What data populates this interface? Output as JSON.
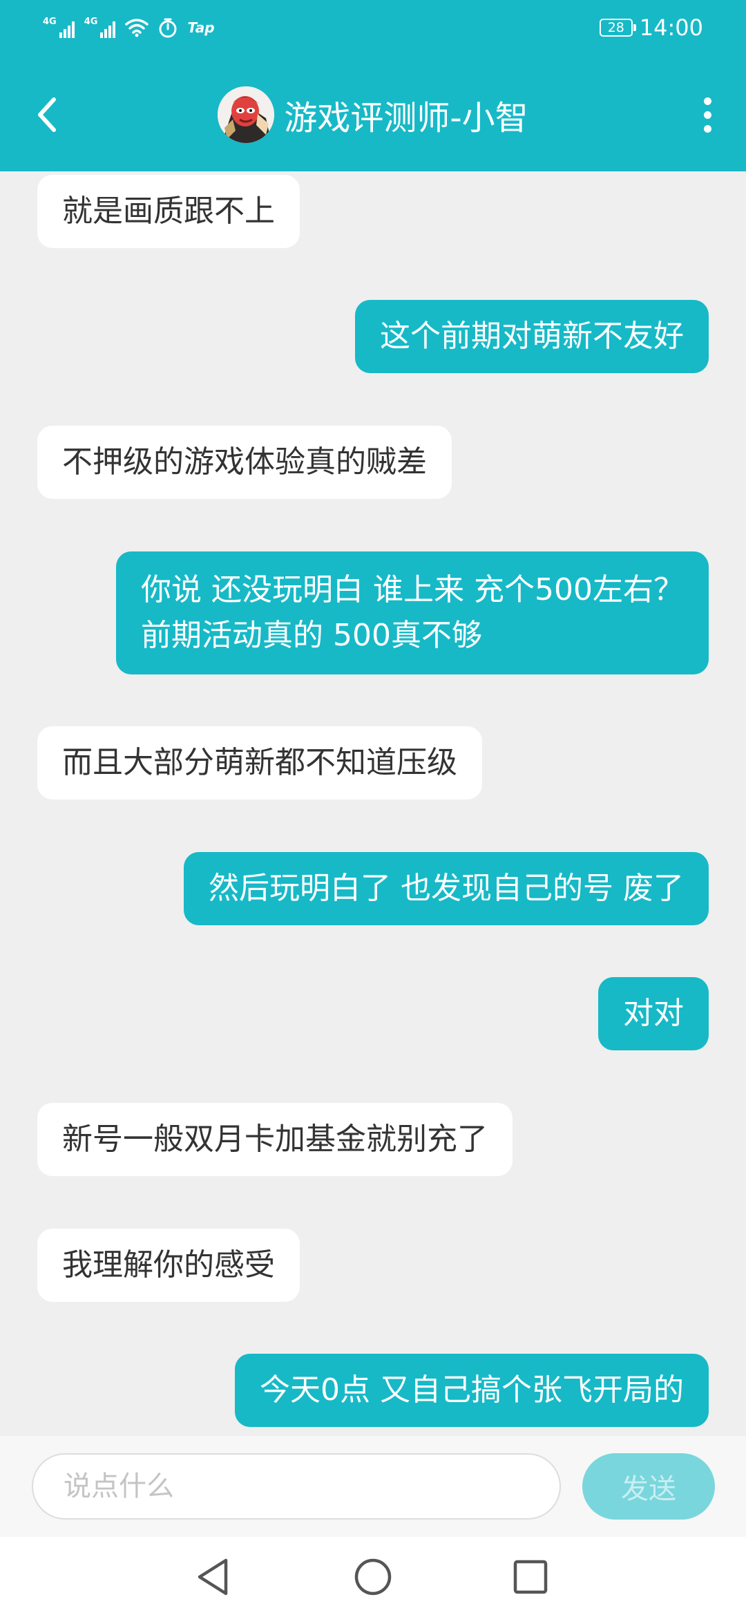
{
  "status_bar": {
    "network_1": "4G",
    "network_2": "4G",
    "app_label": "Tap",
    "battery": "28",
    "time": "14:00"
  },
  "header": {
    "title": "游戏评测师-小智"
  },
  "messages": [
    {
      "side": "in",
      "text": "就是画质跟不上"
    },
    {
      "side": "out",
      "text": "这个前期对萌新不友好"
    },
    {
      "side": "in",
      "text": "不押级的游戏体验真的贼差"
    },
    {
      "side": "out",
      "lines": [
        "你说 还没玩明白 谁上来 充个500左右？",
        "前期活动真的 500真不够"
      ]
    },
    {
      "side": "in",
      "text": "而且大部分萌新都不知道压级"
    },
    {
      "side": "out",
      "text": "然后玩明白了 也发现自己的号 废了"
    },
    {
      "side": "out",
      "text": "对对"
    },
    {
      "side": "in",
      "text": "新号一般双月卡加基金就别充了"
    },
    {
      "side": "in",
      "text": "我理解你的感受"
    },
    {
      "side": "out",
      "text": "今天0点 又自己搞个张飞开局的"
    }
  ],
  "composer": {
    "placeholder": "说点什么",
    "value": "",
    "send_label": "发送"
  },
  "colors": {
    "accent": "#17b9c7",
    "background": "#efefef",
    "incoming_bubble": "#ffffff",
    "send_disabled": "#7ad6dd"
  },
  "icons": {
    "back": "chevron-left-icon",
    "more": "more-vertical-icon",
    "nav_back": "triangle-back-icon",
    "nav_home": "circle-home-icon",
    "nav_recents": "square-recents-icon"
  }
}
